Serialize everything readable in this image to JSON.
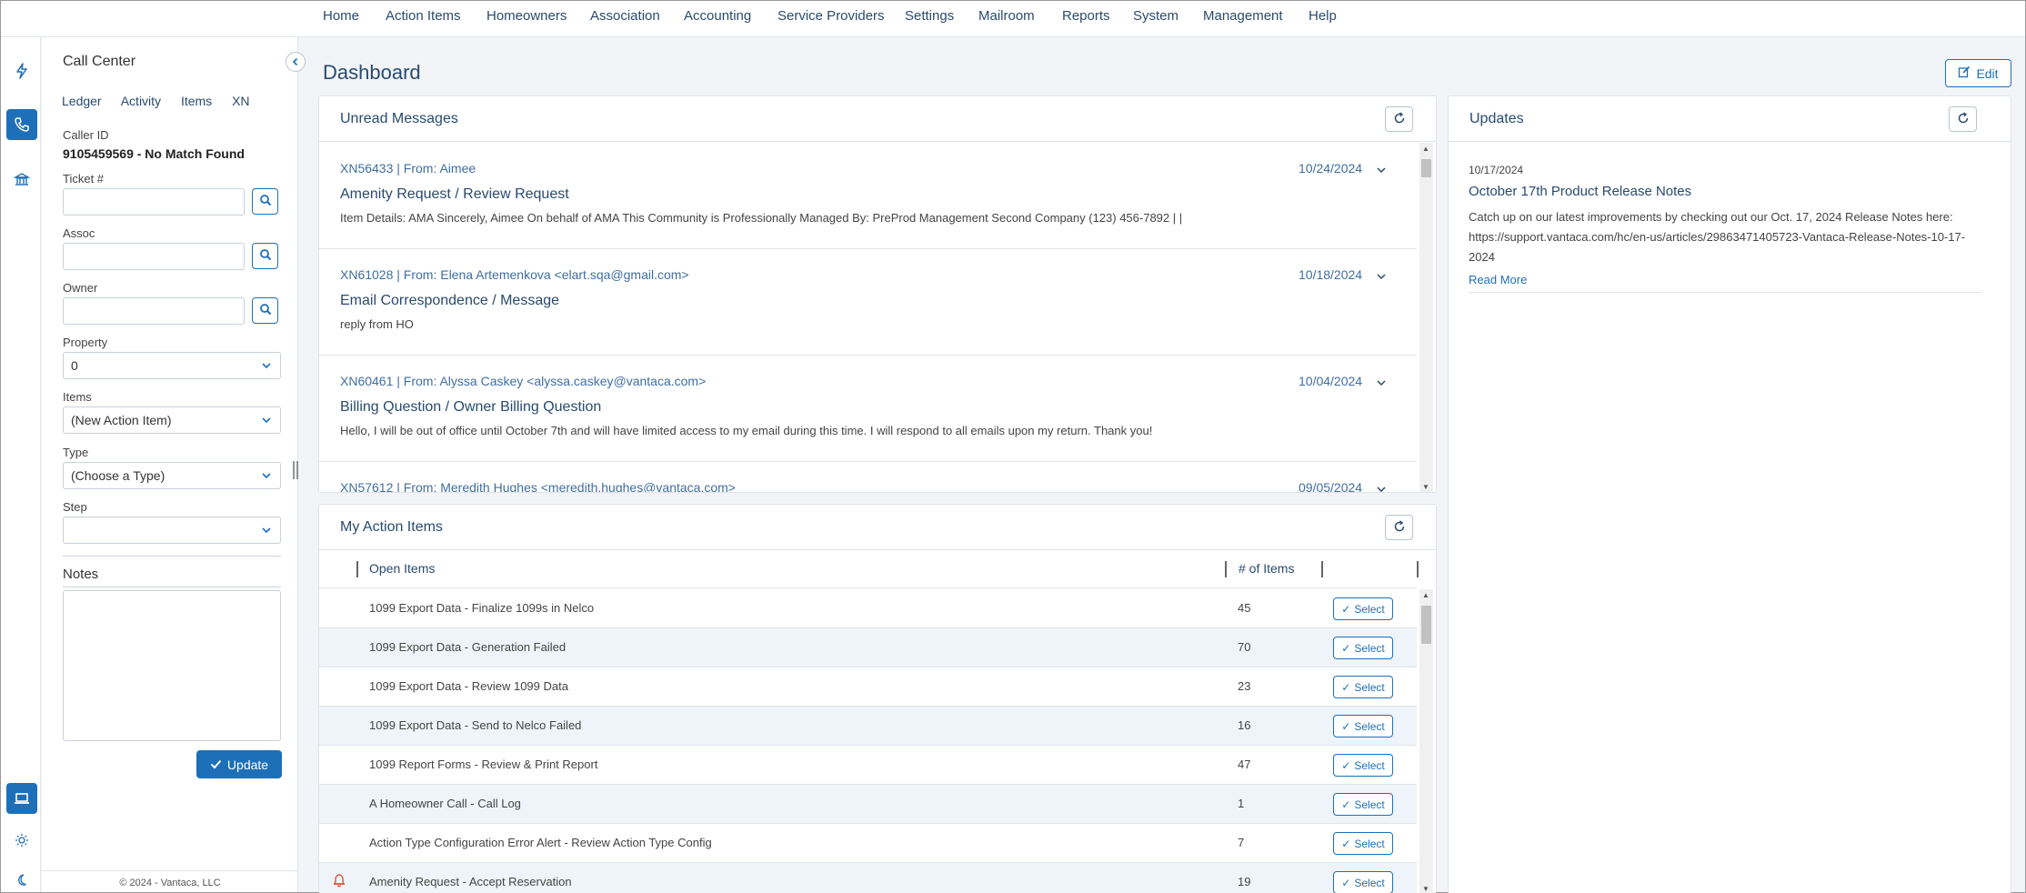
{
  "nav": {
    "items": [
      "Home",
      "Action Items",
      "Homeowners",
      "Association",
      "Accounting",
      "Service Providers",
      "Settings",
      "Mailroom",
      "Reports",
      "System",
      "Management",
      "Help"
    ]
  },
  "rail": {
    "icons": [
      "lightning-icon",
      "phone-icon",
      "bank-icon",
      "laptop-icon",
      "sun-icon",
      "moon-icon"
    ]
  },
  "call_center": {
    "title": "Call Center",
    "tabs": [
      "Ledger",
      "Activity",
      "Items",
      "XN"
    ],
    "caller_id_label": "Caller ID",
    "caller_id_value": "9105459569 - No Match Found",
    "ticket_label": "Ticket #",
    "assoc_label": "Assoc",
    "owner_label": "Owner",
    "property_label": "Property",
    "property_value": "0",
    "items_label": "Items",
    "items_value": "(New Action Item)",
    "type_label": "Type",
    "type_value": "(Choose a Type)",
    "step_label": "Step",
    "step_value": "",
    "notes_label": "Notes",
    "update_label": "Update",
    "copyright": "© 2024 - Vantaca, LLC"
  },
  "dashboard": {
    "title": "Dashboard",
    "edit_label": "Edit"
  },
  "unread_messages": {
    "title": "Unread Messages",
    "messages": [
      {
        "from": "XN56433 | From: Aimee",
        "date": "10/24/2024",
        "subject": "Amenity Request / Review Request",
        "body": "Item Details: AMA Sincerely, Aimee On behalf of AMA This Community is Professionally Managed By: PreProd Management Second Company (123) 456-7892 | |"
      },
      {
        "from": "XN61028 | From: Elena Artemenkova <elart.sqa@gmail.com>",
        "date": "10/18/2024",
        "subject": "Email Correspondence / Message",
        "body": "reply from HO"
      },
      {
        "from": "XN60461 | From: Alyssa Caskey <alyssa.caskey@vantaca.com>",
        "date": "10/04/2024",
        "subject": "Billing Question / Owner Billing Question",
        "body": "Hello, I will be out of office until October 7th and will have limited access to my email during this time. I will respond to all emails upon my return. Thank you!"
      },
      {
        "from": "XN57612 | From: Meredith Hughes <meredith.hughes@vantaca.com>",
        "date": "09/05/2024",
        "subject": "",
        "body": ""
      }
    ]
  },
  "action_items": {
    "title": "My Action Items",
    "col_open": "Open Items",
    "col_count": "# of Items",
    "select_label": "Select",
    "rows": [
      {
        "name": "1099 Export Data - Finalize 1099s in Nelco",
        "count": "45",
        "alert": false
      },
      {
        "name": "1099 Export Data - Generation Failed",
        "count": "70",
        "alert": false
      },
      {
        "name": "1099 Export Data - Review 1099 Data",
        "count": "23",
        "alert": false
      },
      {
        "name": "1099 Export Data - Send to Nelco Failed",
        "count": "16",
        "alert": false
      },
      {
        "name": "1099 Report Forms - Review & Print Report",
        "count": "47",
        "alert": false
      },
      {
        "name": "A Homeowner Call - Call Log",
        "count": "1",
        "alert": false
      },
      {
        "name": "Action Type Configuration Error Alert - Review Action Type Config",
        "count": "7",
        "alert": false
      },
      {
        "name": "Amenity Request - Accept Reservation",
        "count": "19",
        "alert": true
      }
    ]
  },
  "updates": {
    "title": "Updates",
    "date": "10/17/2024",
    "headline": "October 17th Product Release Notes",
    "body": "Catch up on our latest improvements by checking out our Oct. 17, 2024 Release Notes here: https://support.vantaca.com/hc/en-us/articles/29863471405723-Vantaca-Release-Notes-10-17-2024",
    "read_more": "Read More"
  },
  "colors": {
    "accent": "#1d6fb8",
    "heading": "#2a4a6e",
    "link": "#3f6ea3",
    "alert": "#e0523a"
  }
}
